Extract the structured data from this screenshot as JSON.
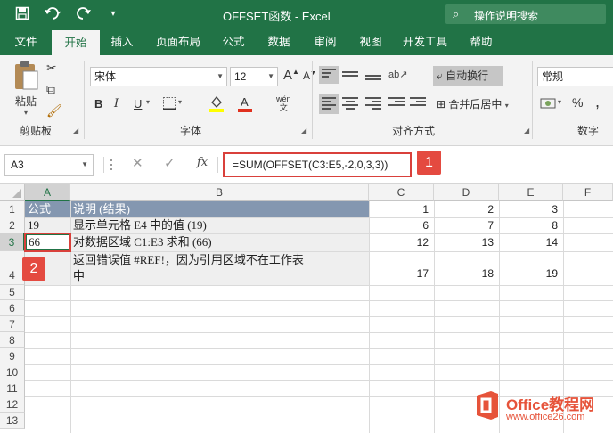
{
  "window": {
    "title": "OFFSET函数  -  Excel",
    "tell_me": "操作说明搜索",
    "qat": {
      "save_icon": "save-icon",
      "undo_icon": "undo-icon",
      "redo_icon": "redo-icon",
      "customize_icon": "chevron-down-icon"
    }
  },
  "ribbon": {
    "tabs": [
      {
        "label": "文件",
        "active": false
      },
      {
        "label": "开始",
        "active": true
      },
      {
        "label": "插入",
        "active": false
      },
      {
        "label": "页面布局",
        "active": false
      },
      {
        "label": "公式",
        "active": false
      },
      {
        "label": "数据",
        "active": false
      },
      {
        "label": "审阅",
        "active": false
      },
      {
        "label": "视图",
        "active": false
      },
      {
        "label": "开发工具",
        "active": false
      },
      {
        "label": "帮助",
        "active": false
      }
    ],
    "clipboard": {
      "paste_label": "粘贴",
      "group_label": "剪贴板"
    },
    "font": {
      "font_name": "宋体",
      "font_size": "12",
      "group_label": "字体",
      "bold": "B",
      "italic": "I",
      "underline": "U",
      "grow": "A",
      "shrink": "A",
      "phonetic": "wén"
    },
    "alignment": {
      "wrap_text": "自动换行",
      "merge_center": "合并后居中",
      "group_label": "对齐方式"
    },
    "number": {
      "format": "常规",
      "group_label": "数字",
      "percent": "%",
      "comma": ","
    }
  },
  "formula_bar": {
    "name_box": "A3",
    "cancel": "✕",
    "enter": "✓",
    "fx": "fx",
    "formula": "=SUM(OFFSET(C3:E5,-2,0,3,3))",
    "callout_1": "1",
    "callout_2": "2"
  },
  "sheet": {
    "columns": [
      "A",
      "B",
      "C",
      "D",
      "E",
      "F"
    ],
    "rows": [
      "1",
      "2",
      "3",
      "4",
      "5",
      "6",
      "7",
      "8",
      "9",
      "10",
      "11",
      "12",
      "13"
    ],
    "cells": {
      "A1": "公式",
      "B1": "说明 (结果)",
      "A2": "19",
      "B2": "显示单元格 E4 中的值 (19)",
      "A3": "66",
      "B3": "对数据区域 C1:E3 求和 (66)",
      "A4": "",
      "B4_line1": "返回错误值 #REF!，因为引用区域不在工作表",
      "B4_line2": "中",
      "C1": "1",
      "D1": "2",
      "E1": "3",
      "C2": "6",
      "D2": "7",
      "E2": "8",
      "C3": "12",
      "D3": "13",
      "E3": "14",
      "C4": "17",
      "D4": "18",
      "E4": "19"
    }
  },
  "watermark": {
    "line1": "Office教程网",
    "line2": "www.office26.com"
  },
  "colors": {
    "excel_green": "#217346",
    "header_fill": "#8497b0",
    "callout_red": "#e44a40"
  }
}
